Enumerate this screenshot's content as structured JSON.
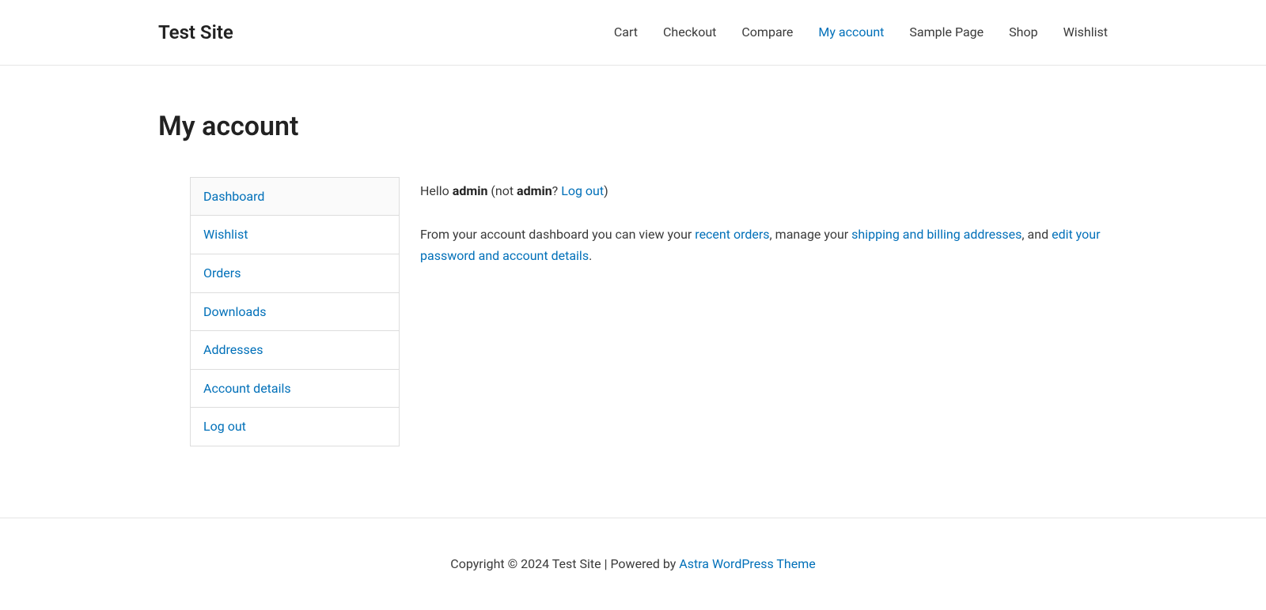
{
  "header": {
    "site_title": "Test Site",
    "nav": [
      {
        "label": "Cart",
        "active": false
      },
      {
        "label": "Checkout",
        "active": false
      },
      {
        "label": "Compare",
        "active": false
      },
      {
        "label": "My account",
        "active": true
      },
      {
        "label": "Sample Page",
        "active": false
      },
      {
        "label": "Shop",
        "active": false
      },
      {
        "label": "Wishlist",
        "active": false
      }
    ]
  },
  "page": {
    "title": "My account"
  },
  "account_nav": [
    {
      "label": "Dashboard",
      "active": true
    },
    {
      "label": "Wishlist",
      "active": false
    },
    {
      "label": "Orders",
      "active": false
    },
    {
      "label": "Downloads",
      "active": false
    },
    {
      "label": "Addresses",
      "active": false
    },
    {
      "label": "Account details",
      "active": false
    },
    {
      "label": "Log out",
      "active": false
    }
  ],
  "content": {
    "hello_prefix": "Hello ",
    "username": "admin",
    "not_prefix": " (not ",
    "not_username": "admin",
    "not_suffix": "? ",
    "logout_link": "Log out",
    "closing_paren": ")",
    "para2_1": "From your account dashboard you can view your ",
    "link_orders": "recent orders",
    "para2_2": ", manage your ",
    "link_addresses": "shipping and billing addresses",
    "para2_3": ", and ",
    "link_account": "edit your password and account details",
    "para2_4": "."
  },
  "footer": {
    "text_1": "Copyright © 2024 Test Site | Powered by ",
    "theme_link": "Astra WordPress Theme"
  }
}
